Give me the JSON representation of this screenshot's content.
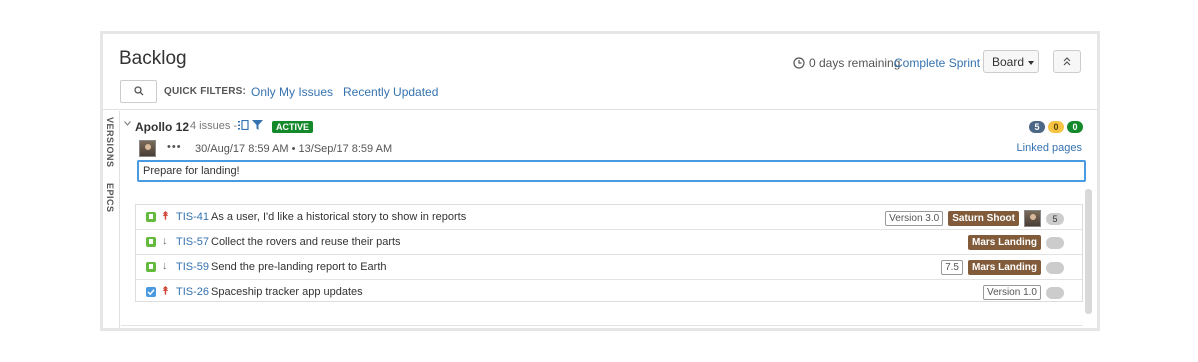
{
  "header": {
    "title": "Backlog",
    "quick_filters_label": "QUICK FILTERS:",
    "filters": [
      "Only My Issues",
      "Recently Updated"
    ],
    "remaining": "0 days remaining",
    "complete_sprint": "Complete Sprint",
    "board_label": "Board"
  },
  "side_tabs": [
    "VERSIONS",
    "EPICS"
  ],
  "sprint": {
    "name": "Apollo 12",
    "issue_count": "4 issues",
    "separator": "-",
    "status": "ACTIVE",
    "counts": [
      {
        "value": "5",
        "color": "#4a6785"
      },
      {
        "value": "0",
        "color": "#f6c342"
      },
      {
        "value": "0",
        "color": "#14892c"
      }
    ],
    "dots": "•••",
    "dates": "30/Aug/17 8:59 AM • 13/Sep/17 8:59 AM",
    "linked_pages": "Linked pages",
    "goal": "Prepare for landing!"
  },
  "issues": [
    {
      "type": "story",
      "priority": "high",
      "key": "TIS-41",
      "summary": "As a user, I'd like a historical story to show in reports",
      "version": "Version 3.0",
      "epic": "Saturn Shoot",
      "has_avatar": true,
      "estimate": "5"
    },
    {
      "type": "story",
      "priority": "low",
      "key": "TIS-57",
      "summary": "Collect the rovers and reuse their parts",
      "version": "",
      "epic": "Mars Landing",
      "has_avatar": false,
      "estimate": ""
    },
    {
      "type": "story",
      "priority": "low",
      "key": "TIS-59",
      "summary": "Send the pre-landing report to Earth",
      "version": "7.5",
      "epic": "Mars Landing",
      "has_avatar": false,
      "estimate": ""
    },
    {
      "type": "task",
      "priority": "high",
      "key": "TIS-26",
      "summary": "Spaceship tracker app updates",
      "version": "Version 1.0",
      "epic": "",
      "has_avatar": false,
      "estimate": ""
    }
  ]
}
